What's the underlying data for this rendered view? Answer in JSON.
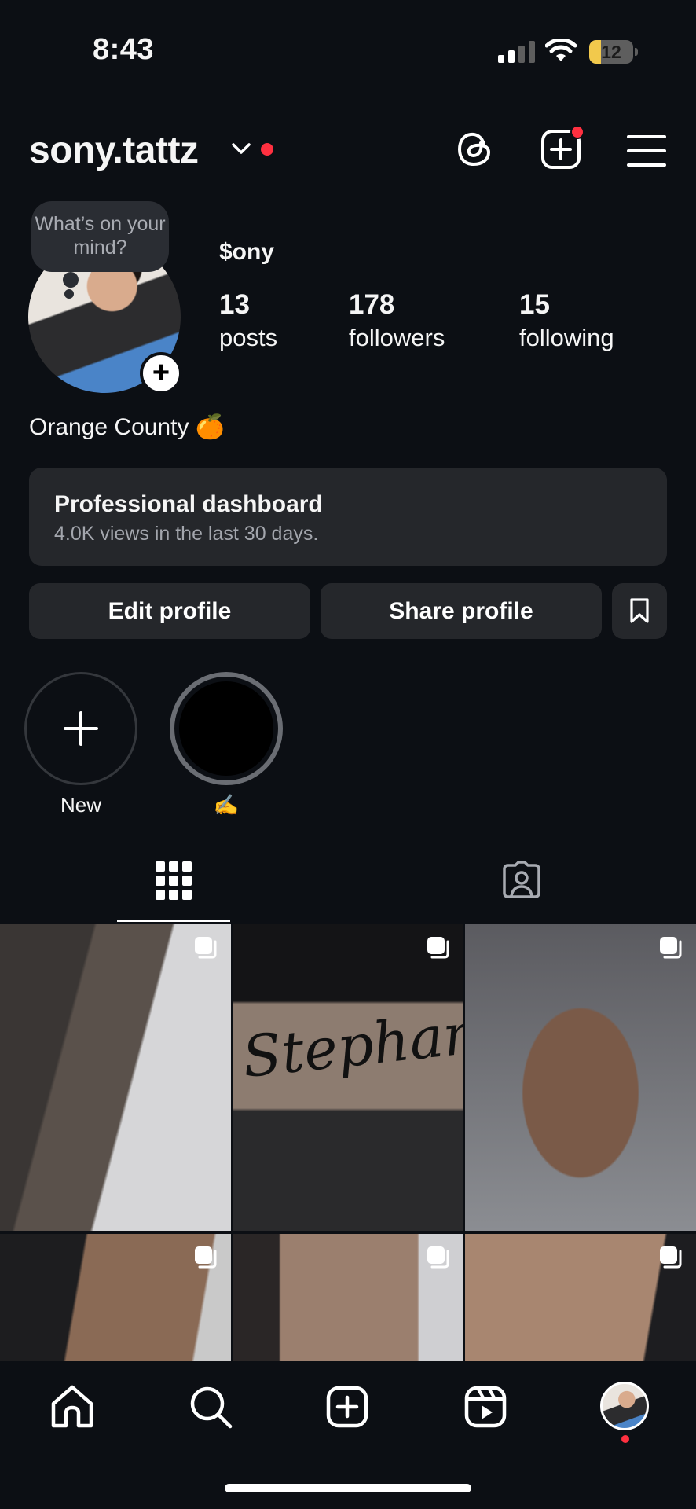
{
  "status_bar": {
    "time": "8:43",
    "battery": "12",
    "battery_level": 0.12
  },
  "header": {
    "username": "sony.tattz",
    "accent": "#ff3040"
  },
  "profile": {
    "prompt_bubble": "What’s on your mind?",
    "display_name": "$ony",
    "stats": [
      {
        "value": "13",
        "label": "posts"
      },
      {
        "value": "178",
        "label": "followers"
      },
      {
        "value": "15",
        "label": "following"
      }
    ],
    "bio": "Orange County 🍊"
  },
  "dashboard": {
    "title": "Professional dashboard",
    "subtitle": "4.0K views in the last 30 days."
  },
  "buttons": {
    "edit": "Edit profile",
    "share": "Share profile"
  },
  "highlights": [
    {
      "label": "New"
    },
    {
      "label": "✍️"
    }
  ],
  "tabs": {
    "active": "posts-grid"
  },
  "posts": [
    {
      "overlay_text": ""
    },
    {
      "overlay_text": "Stephanie"
    },
    {
      "overlay_text": ""
    },
    {
      "overlay_text": ""
    },
    {
      "overlay_text": ""
    },
    {
      "overlay_text": ""
    }
  ],
  "nav": {
    "items": [
      "home-icon",
      "search-icon",
      "create-icon",
      "reels-icon",
      "profile-avatar"
    ]
  }
}
